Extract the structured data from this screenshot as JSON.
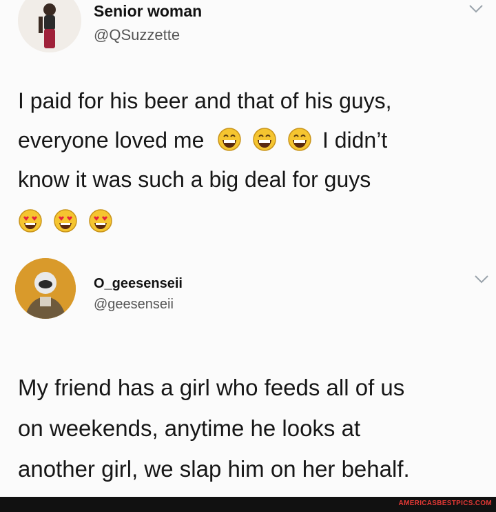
{
  "tweets": [
    {
      "display_name": "Senior woman",
      "handle": "@QSuzzette",
      "text_lines": [
        "I paid for his beer and that of his guys,",
        "everyone loved me",
        "I didn’t",
        "know it was such a big deal for guys"
      ],
      "emojis_inline": [
        "grinning-face-icon",
        "grinning-face-icon",
        "grinning-face-icon"
      ],
      "emojis_after": [
        "heart-eyes-face-icon",
        "heart-eyes-face-icon",
        "heart-eyes-face-icon"
      ]
    },
    {
      "display_name": "O_geesenseii",
      "handle": "@geesenseii",
      "text_lines": [
        "My friend has a girl who feeds all of us",
        "on weekends, anytime he looks at",
        "another girl, we slap him on her behalf."
      ]
    }
  ],
  "watermark": "AMERICASBESTPICS.COM",
  "colors": {
    "background": "#fbfbfb",
    "watermark_bg": "#111111",
    "watermark_text": "#e53935",
    "emoji_face": "#f5c530"
  }
}
